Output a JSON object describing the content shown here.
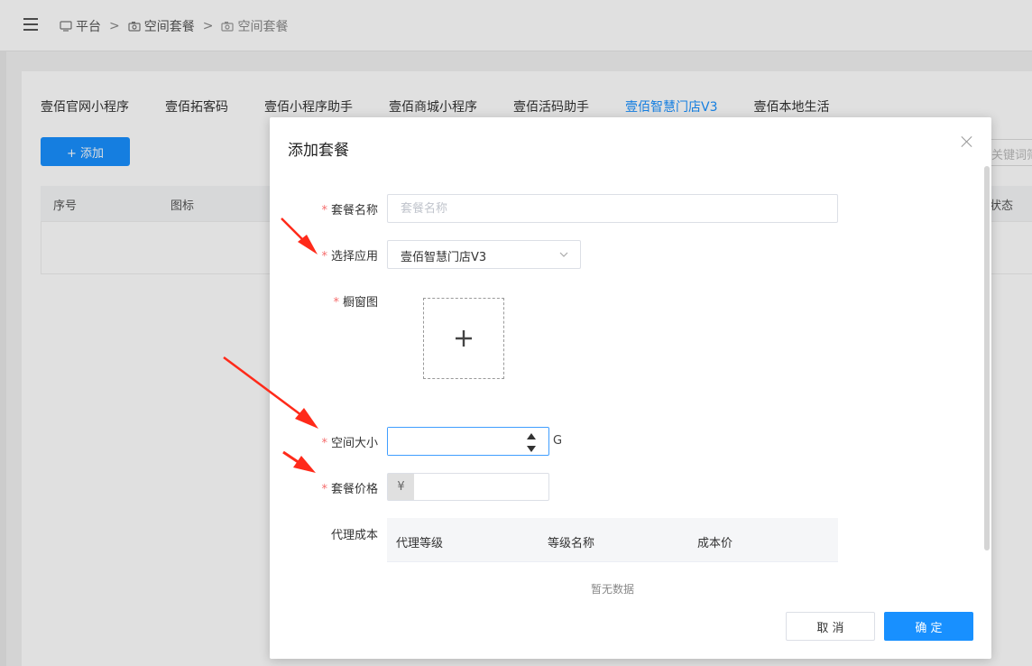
{
  "breadcrumb": {
    "items": [
      "平台",
      "空间套餐",
      "空间套餐"
    ],
    "separator": ">"
  },
  "tabs": [
    {
      "label": "壹佰官网小程序",
      "active": false
    },
    {
      "label": "壹佰拓客码",
      "active": false
    },
    {
      "label": "壹佰小程序助手",
      "active": false
    },
    {
      "label": "壹佰商城小程序",
      "active": false
    },
    {
      "label": "壹佰活码助手",
      "active": false
    },
    {
      "label": "壹佰智慧门店V3",
      "active": true
    },
    {
      "label": "壹佰本地生活",
      "active": false
    }
  ],
  "toolbar": {
    "add_label": "+ 添加",
    "search_placeholder": "关键词筛"
  },
  "table": {
    "columns": [
      "序号",
      "图标",
      "状态"
    ]
  },
  "modal": {
    "title": "添加套餐",
    "fields": {
      "name": {
        "label": "套餐名称",
        "placeholder": "套餐名称",
        "required": true
      },
      "app": {
        "label": "选择应用",
        "value": "壹佰智慧门店V3",
        "required": true
      },
      "window_image": {
        "label": "橱窗图",
        "required": true
      },
      "space": {
        "label": "空间大小",
        "unit": "G",
        "required": true
      },
      "price": {
        "label": "套餐价格",
        "prefix": "¥",
        "required": true
      },
      "agent_cost": {
        "label": "代理成本"
      }
    },
    "required_mark": "*",
    "cost_table": {
      "columns": [
        "代理等级",
        "等级名称",
        "成本价"
      ],
      "empty_text": "暂无数据"
    },
    "cancel_label": "取 消",
    "confirm_label": "确 定"
  },
  "colors": {
    "primary": "#1890ff",
    "required": "#f56c6c",
    "annotation_arrow": "#ff2a1a"
  }
}
